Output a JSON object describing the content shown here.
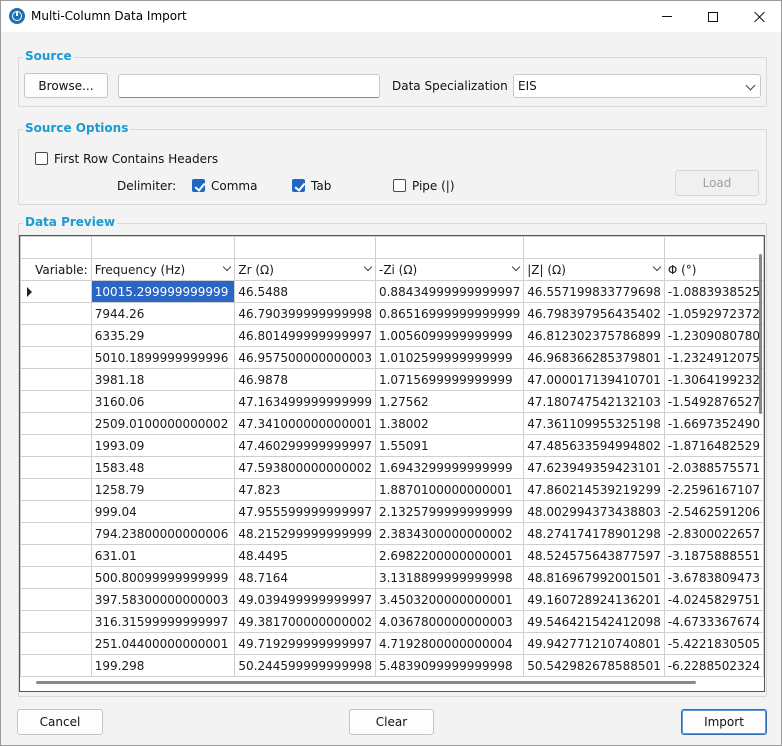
{
  "window": {
    "title": "Multi-Column Data Import"
  },
  "source": {
    "group_label": "Source",
    "browse_label": "Browse...",
    "file_path_value": "",
    "specialization_label": "Data Specialization",
    "specialization_value": "EIS"
  },
  "options": {
    "group_label": "Source Options",
    "first_row_headers_label": "First Row Contains Headers",
    "delimiter_label": "Delimiter:",
    "comma_label": "Comma",
    "tab_label": "Tab",
    "pipe_label": "Pipe (|)",
    "load_label": "Load"
  },
  "preview": {
    "group_label": "Data Preview",
    "variable_label": "Variable:",
    "columns": [
      "Frequency (Hz)",
      "Zr (Ω)",
      "-Zi (Ω)",
      "|Z| (Ω)",
      "Φ (°)"
    ],
    "rows": [
      [
        "10015.299999999999",
        "46.5488",
        "0.88434999999999997",
        "46.557199833779698",
        "-1.0883938525"
      ],
      [
        "7944.26",
        "46.790399999999998",
        "0.86516999999999999",
        "46.798397956435402",
        "-1.0592972372"
      ],
      [
        "6335.29",
        "46.801499999999997",
        "1.0056099999999999",
        "46.812302375786899",
        "-1.2309080780"
      ],
      [
        "5010.1899999999996",
        "46.957500000000003",
        "1.0102599999999999",
        "46.968366285379801",
        "-1.2324912075"
      ],
      [
        "3981.18",
        "46.9878",
        "1.0715699999999999",
        "47.000017139410701",
        "-1.3064199232"
      ],
      [
        "3160.06",
        "47.163499999999999",
        "1.27562",
        "47.180747542132103",
        "-1.5492876527"
      ],
      [
        "2509.0100000000002",
        "47.341000000000001",
        "1.38002",
        "47.361109955325198",
        "-1.6697352490"
      ],
      [
        "1993.09",
        "47.460299999999997",
        "1.55091",
        "47.485633594994802",
        "-1.8716482529"
      ],
      [
        "1583.48",
        "47.593800000000002",
        "1.6943299999999999",
        "47.623949359423101",
        "-2.0388575571"
      ],
      [
        "1258.79",
        "47.823",
        "1.8870100000000001",
        "47.860214539219299",
        "-2.2596167107"
      ],
      [
        "999.04",
        "47.955599999999997",
        "2.1325799999999999",
        "48.002994373438803",
        "-2.5462591206"
      ],
      [
        "794.23800000000006",
        "48.215299999999999",
        "2.3834300000000002",
        "48.274174178901298",
        "-2.8300022657"
      ],
      [
        "631.01",
        "48.4495",
        "2.6982200000000001",
        "48.524575643877597",
        "-3.1875888551"
      ],
      [
        "500.80099999999999",
        "48.7164",
        "3.1318899999999998",
        "48.816967992001501",
        "-3.6783809473"
      ],
      [
        "397.58300000000003",
        "49.039499999999997",
        "3.4503200000000001",
        "49.160728924136201",
        "-4.0245829751"
      ],
      [
        "316.31599999999997",
        "49.381700000000002",
        "4.0367800000000003",
        "49.546421542412098",
        "-4.6733367674"
      ],
      [
        "251.04400000000001",
        "49.719299999999997",
        "4.7192800000000004",
        "49.942771210740801",
        "-5.4221830505"
      ],
      [
        "199.298",
        "50.244599999999998",
        "5.4839099999999998",
        "50.542982678588501",
        "-6.2288502324"
      ]
    ]
  },
  "footer": {
    "cancel_label": "Cancel",
    "clear_label": "Clear",
    "import_label": "Import"
  }
}
